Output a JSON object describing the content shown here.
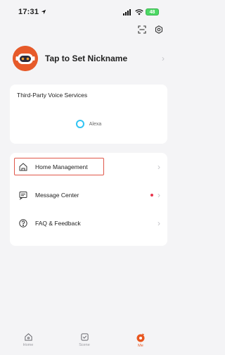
{
  "status_bar": {
    "time": "17:31",
    "battery": "48"
  },
  "profile": {
    "nickname": "Tap to Set Nickname"
  },
  "voice_services": {
    "title": "Third-Party Voice Services",
    "alexa_label": "Alexa"
  },
  "menu": {
    "items": [
      {
        "label": "Home Management",
        "icon": "home-icon"
      },
      {
        "label": "Message Center",
        "icon": "message-icon",
        "unread": true
      },
      {
        "label": "FAQ & Feedback",
        "icon": "question-icon"
      }
    ]
  },
  "tabbar": {
    "tabs": [
      {
        "label": "Home",
        "active": false
      },
      {
        "label": "Scene",
        "active": false
      },
      {
        "label": "Me",
        "active": true
      }
    ]
  },
  "colors": {
    "accent": "#e8561f",
    "highlight": "#e0574a",
    "alexa": "#31c4f3"
  }
}
